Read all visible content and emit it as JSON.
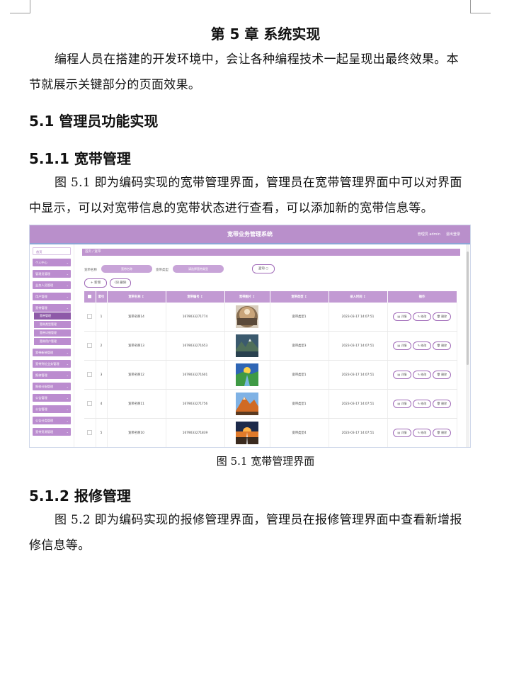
{
  "doc": {
    "chapter_title": "第 5 章  系统实现",
    "intro_para": "编程人员在搭建的开发环境中，会让各种编程技术一起呈现出最终效果。本节就展示关键部分的页面效果。",
    "section_5_1": "5.1  管理员功能实现",
    "section_5_1_1": "5.1.1  宽带管理",
    "para_5_1_1": "图 5.1  即为编码实现的宽带管理界面，管理员在宽带管理界面中可以对界面中显示，可以对宽带信息的宽带状态进行查看，可以添加新的宽带信息等。",
    "figure_caption": "图 5.1  宽带管理界面",
    "section_5_1_2": "5.1.2  报修管理",
    "para_5_1_2": "图 5.2  即为编码实现的报修管理界面，管理员在报修管理界面中查看新增报修信息等。"
  },
  "screenshot": {
    "app_title": "宽带业务管理系统",
    "user": "管理员 admin",
    "logout": "退出登录",
    "breadcrumb": "首页  /  宽带",
    "filter_label_1": "宽带名称",
    "filter_placeholder_1": "宽带名称",
    "filter_label_2": "宽带类型",
    "filter_placeholder_2": "请选择宽带类型",
    "query_btn": "查询 ○",
    "add_btn": "+ 新增",
    "delete_btn": "⌫ 删除",
    "sidebar": [
      {
        "label": "首页",
        "kind": "plain"
      },
      {
        "label": "个人中心",
        "kind": "fill"
      },
      {
        "label": "管理员管理",
        "kind": "fill"
      },
      {
        "label": "业务人员管理",
        "kind": "fill"
      },
      {
        "label": "用户管理",
        "kind": "fill"
      },
      {
        "label": "宽带管理",
        "kind": "fill"
      }
    ],
    "sidebar_sub": [
      "宽带管理",
      "宽带类型管理",
      "宽带详细管理",
      "宽带用户管理"
    ],
    "sidebar_more": [
      "宽带新装管理",
      "宽带到位业务管理",
      "报修管理",
      "报修分配管理",
      "公告管理",
      "公告管理",
      "公告分类管理",
      "宽带资源管理"
    ],
    "columns": [
      "",
      "索引",
      "宽带名称 ↕",
      "宽带编号 ↕",
      "宽带图片 ↕",
      "宽带类型 ↕",
      "录入时间 ↕",
      "操作"
    ],
    "rows": [
      {
        "idx": "1",
        "name": "宽带名称14",
        "code": "1679033271774",
        "type": "宽带类型1",
        "time": "2023-03-17 14:07:51",
        "img": "sphere"
      },
      {
        "idx": "2",
        "name": "宽带名称13",
        "code": "1679033271653",
        "type": "宽带类型3",
        "time": "2023-03-17 14:07:51",
        "img": "mountain"
      },
      {
        "idx": "3",
        "name": "宽带名称12",
        "code": "1679033271601",
        "type": "宽带类型1",
        "time": "2023-03-17 14:07:51",
        "img": "valley"
      },
      {
        "idx": "4",
        "name": "宽带名称11",
        "code": "1679033271756",
        "type": "宽带类型1",
        "time": "2023-03-17 14:07:51",
        "img": "peak"
      },
      {
        "idx": "5",
        "name": "宽带名称10",
        "code": "1679033271839",
        "type": "宽带类型4",
        "time": "2023-03-17 14:07:51",
        "img": "road"
      }
    ],
    "ops": [
      "▤ 详情",
      "✎ 修改",
      "🗑 删除"
    ]
  }
}
